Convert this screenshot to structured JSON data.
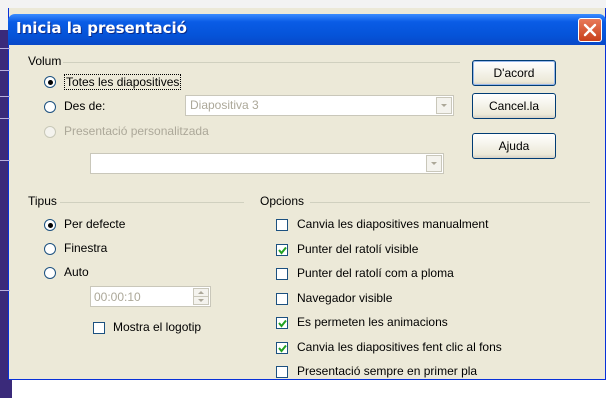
{
  "dialog": {
    "title": "Inicia la presentació"
  },
  "volum": {
    "label": "Volum",
    "all_slides": "Totes les diapositives",
    "from": "Des de:",
    "from_value": "Diapositiva 3",
    "custom": "Presentació personalitzada",
    "custom_value": ""
  },
  "tipus": {
    "label": "Tipus",
    "default": "Per defecte",
    "window": "Finestra",
    "auto": "Auto",
    "time": "00:00:10",
    "show_logo": "Mostra el logotip"
  },
  "opcions": {
    "label": "Opcions",
    "items": [
      {
        "label": "Canvia les diapositives manualment",
        "checked": false
      },
      {
        "label": "Punter del ratolí visible",
        "checked": true
      },
      {
        "label": "Punter del ratolí com a ploma",
        "checked": false
      },
      {
        "label": "Navegador visible",
        "checked": false
      },
      {
        "label": "Es permeten les animacions",
        "checked": true
      },
      {
        "label": "Canvia les diapositives fent clic al fons",
        "checked": true
      },
      {
        "label": "Presentació sempre en primer pla",
        "checked": false
      }
    ]
  },
  "buttons": {
    "ok": "D'acord",
    "cancel": "Cancel.la",
    "help": "Ajuda"
  },
  "colors": {
    "title_bar": "#0553d8",
    "dialog_bg": "#ece9d8",
    "close": "#c8401c"
  }
}
